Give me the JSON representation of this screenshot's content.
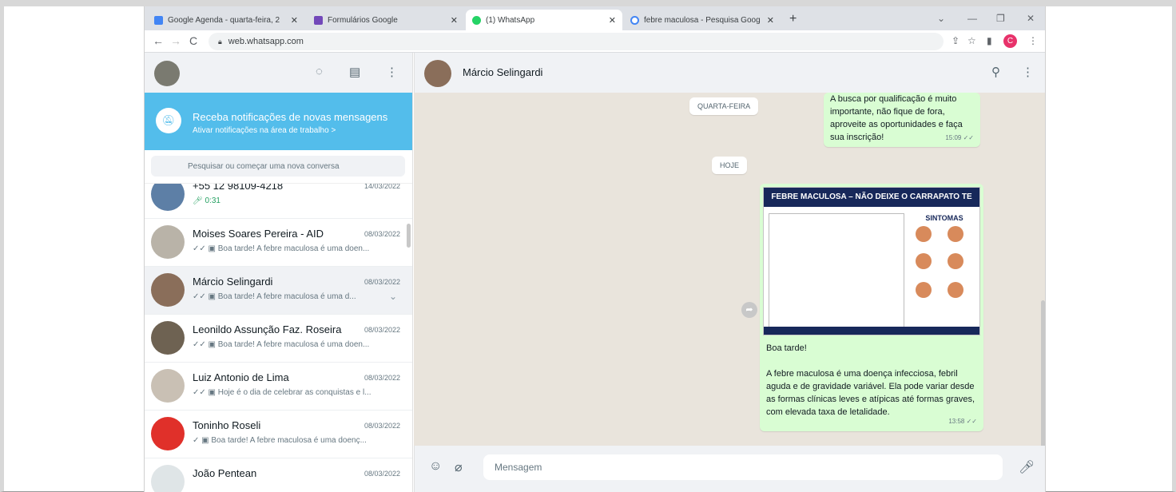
{
  "browser": {
    "tabs": [
      {
        "title": "Google Agenda - quarta-feira, 2",
        "icon": "calendar-icon",
        "color": "#4285f4"
      },
      {
        "title": "Formulários Google",
        "icon": "forms-icon",
        "color": "#7248b9"
      },
      {
        "title": "(1) WhatsApp",
        "icon": "whatsapp-icon",
        "color": "#25d366"
      },
      {
        "title": "febre maculosa - Pesquisa Goog",
        "icon": "google-icon",
        "color": "#4285f4"
      }
    ],
    "new_tab": "+",
    "url": "web.whatsapp.com",
    "profile_initial": "C"
  },
  "sidebar": {
    "notification": {
      "title": "Receba notificações de novas mensagens",
      "subtitle": "Ativar notificações na área de trabalho >"
    },
    "search_placeholder": "Pesquisar ou começar uma nova conversa",
    "chats": [
      {
        "name": "+55 12 98109-4218",
        "time": "14/03/2022",
        "preview": "0:31"
      },
      {
        "name": "Moises Soares Pereira - AID",
        "time": "08/03/2022",
        "preview": "✓✓ ▣ Boa tarde! A febre maculosa é uma doen..."
      },
      {
        "name": "Márcio Selingardi",
        "time": "08/03/2022",
        "preview": "✓✓ ▣ Boa tarde! A febre maculosa é uma d..."
      },
      {
        "name": "Leonildo Assunção Faz. Roseira",
        "time": "08/03/2022",
        "preview": "✓✓ ▣ Boa tarde! A febre maculosa é uma doen..."
      },
      {
        "name": "Luiz Antonio de Lima",
        "time": "08/03/2022",
        "preview": "✓✓ ▣ Hoje é o dia de celebrar as conquistas e l..."
      },
      {
        "name": "Toninho Roseli",
        "time": "08/03/2022",
        "preview": "✓ ▣ Boa tarde! A febre maculosa é uma doenç..."
      },
      {
        "name": "João Pentean",
        "time": "08/03/2022",
        "preview": ""
      }
    ]
  },
  "conversation": {
    "contact": "Márcio Selingardi",
    "day_labels": [
      "QUARTA-FEIRA",
      "HOJE"
    ],
    "msg1": {
      "text": "A busca por qualificação é muito importante, não fique de fora, aproveite as oportunidades e faça sua inscrição!",
      "time": "15:09"
    },
    "poster": {
      "title": "FEBRE MACULOSA – NÃO DEIXE O CARRAPATO TE PEGAR",
      "symptoms": "SINTOMAS"
    },
    "msg2": {
      "greeting": "Boa tarde!",
      "body": "A febre maculosa é uma doença infecciosa, febril aguda e de gravidade variável. Ela pode variar desde as formas clínicas leves e atípicas até formas graves, com elevada taxa de letalidade.",
      "time": "13:58"
    },
    "compose_placeholder": "Mensagem"
  }
}
